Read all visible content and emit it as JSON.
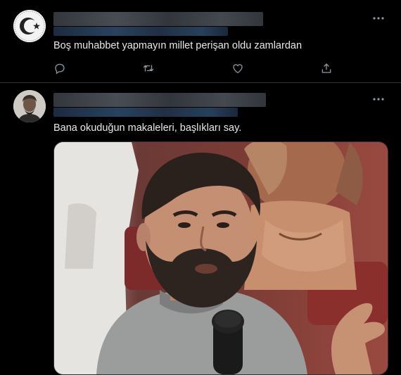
{
  "tweets": [
    {
      "text": "Boş muhabbet yapmayın millet perişan oldu zamlardan",
      "actions": [
        {
          "icon": "reply-icon"
        },
        {
          "icon": "retweet-icon"
        },
        {
          "icon": "like-icon"
        },
        {
          "icon": "share-icon"
        }
      ]
    },
    {
      "text": "Bana okuduğun makaleleri, başlıkları say."
    }
  ],
  "icons": {
    "more": "more-options-icon",
    "avatar1": "crescent-star-avatar",
    "avatar2": "profile-photo-avatar",
    "media": "video-thumbnail"
  },
  "colors": {
    "background": "#000000",
    "text": "#e7e9ea",
    "secondary": "#8b98a5",
    "divider": "#2f3336"
  }
}
